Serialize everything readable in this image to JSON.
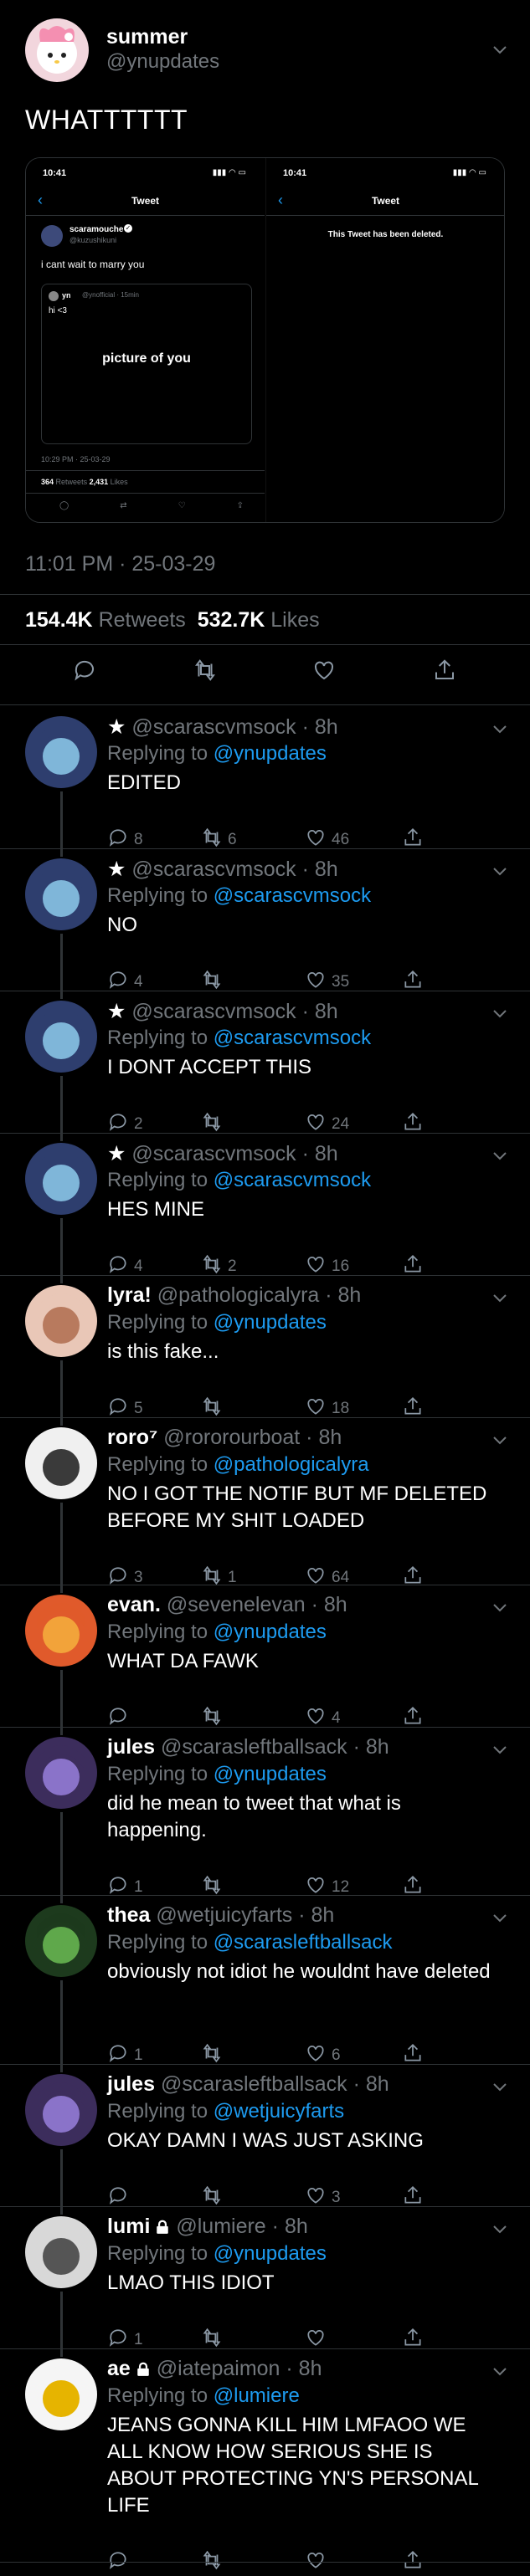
{
  "header": {
    "name": "summer",
    "handle": "@ynupdates",
    "text": "WHATTTTTT"
  },
  "embed": {
    "left": {
      "time": "10:41",
      "title": "Tweet",
      "name": "scaramouche",
      "handle": "@kuzushikuni",
      "text": "i cant wait to marry you",
      "quote_name": "yn",
      "quote_handle": "@ynofficial · 15min",
      "quote_text": "hi <3",
      "quote_image_text": "picture of you",
      "stamp": "10:29 PM · 25-03-29",
      "retweets": "364",
      "retweets_label": "Retweets",
      "likes": "2,431",
      "likes_label": "Likes"
    },
    "right": {
      "time": "10:41",
      "title": "Tweet",
      "deleted": "This Tweet has been deleted."
    }
  },
  "meta": {
    "timestamp": "11:01 PM · 25-03-29",
    "retweets": "154.4K",
    "retweets_label": "Retweets",
    "likes": "532.7K",
    "likes_label": "Likes"
  },
  "colors": {
    "accent": "#1d9bf0",
    "muted": "#71767b",
    "divider": "#2f3336"
  },
  "replies": [
    {
      "name": "",
      "star": "★",
      "handle": "@scarascvmsock",
      "time": "8h",
      "reply_to_label": "Replying to",
      "reply_to": "@ynupdates",
      "text": "EDITED",
      "comments": "8",
      "retweets": "6",
      "likes": "46",
      "avatar": "blue"
    },
    {
      "name": "",
      "star": "★",
      "handle": "@scarascvmsock",
      "time": "8h",
      "reply_to_label": "Replying to",
      "reply_to": "@scarascvmsock",
      "text": "NO",
      "comments": "4",
      "retweets": "",
      "likes": "35",
      "avatar": "blue"
    },
    {
      "name": "",
      "star": "★",
      "handle": "@scarascvmsock",
      "time": "8h",
      "reply_to_label": "Replying to",
      "reply_to": "@scarascvmsock",
      "text": "I DONT ACCEPT THIS",
      "comments": "2",
      "retweets": "",
      "likes": "24",
      "avatar": "blue"
    },
    {
      "name": "",
      "star": "★",
      "handle": "@scarascvmsock",
      "time": "8h",
      "reply_to_label": "Replying to",
      "reply_to": "@scarascvmsock",
      "text": "HES MINE",
      "comments": "4",
      "retweets": "2",
      "likes": "16",
      "avatar": "blue"
    },
    {
      "name": "lyra!",
      "star": "",
      "handle": "@pathologicalyra",
      "time": "8h",
      "reply_to_label": "Replying to",
      "reply_to": "@ynupdates",
      "text": "is this fake...",
      "comments": "5",
      "retweets": "",
      "likes": "18",
      "avatar": "pink"
    },
    {
      "name": "roro⁷",
      "star": "",
      "handle": "@rororourboat",
      "time": "8h",
      "reply_to_label": "Replying to",
      "reply_to": "@pathologicalyra",
      "text": "NO I GOT THE NOTIF BUT MF DELETED BEFORE MY SHIT LOADED",
      "comments": "3",
      "retweets": "1",
      "likes": "64",
      "avatar": "white"
    },
    {
      "name": "evan.",
      "star": "",
      "handle": "@sevenelevan",
      "time": "8h",
      "reply_to_label": "Replying to",
      "reply_to": "@ynupdates",
      "text": "WHAT DA FAWK",
      "comments": "",
      "retweets": "",
      "likes": "4",
      "avatar": "orange"
    },
    {
      "name": "jules",
      "star": "",
      "handle": "@scarasleftballsack",
      "time": "8h",
      "reply_to_label": "Replying to",
      "reply_to": "@ynupdates",
      "text": "did he mean to tweet that what is happening.",
      "comments": "1",
      "retweets": "",
      "likes": "12",
      "avatar": "purple"
    },
    {
      "name": "thea",
      "star": "",
      "handle": "@wetjuicyfarts",
      "time": "8h",
      "reply_to_label": "Replying to",
      "reply_to": "@scarasleftballsack",
      "text": "obviously not idiot he wouldnt have deleted",
      "comments": "1",
      "retweets": "",
      "likes": "6",
      "avatar": "green"
    },
    {
      "name": "jules",
      "star": "",
      "handle": "@scarasleftballsack",
      "time": "8h",
      "reply_to_label": "Replying to",
      "reply_to": "@wetjuicyfarts",
      "text": "OKAY DAMN I WAS JUST ASKING",
      "comments": "",
      "retweets": "",
      "likes": "3",
      "avatar": "purple"
    },
    {
      "name": "lumi",
      "star": "",
      "handle": "@lumiere",
      "time": "8h",
      "reply_to_label": "Replying to",
      "reply_to": "@ynupdates",
      "text": "LMAO THIS IDIOT",
      "comments": "1",
      "retweets": "",
      "likes": "",
      "avatar": "grey",
      "locked": true
    },
    {
      "name": "ae",
      "star": "",
      "handle": "@iatepaimon",
      "time": "8h",
      "reply_to_label": "Replying to",
      "reply_to": "@lumiere",
      "text": "JEANS GONNA KILL HIM LMFAOO WE ALL KNOW HOW SERIOUS SHE IS ABOUT PROTECTING YN'S PERSONAL LIFE",
      "comments": "",
      "retweets": "",
      "likes": "",
      "avatar": "bird",
      "locked": true
    }
  ]
}
